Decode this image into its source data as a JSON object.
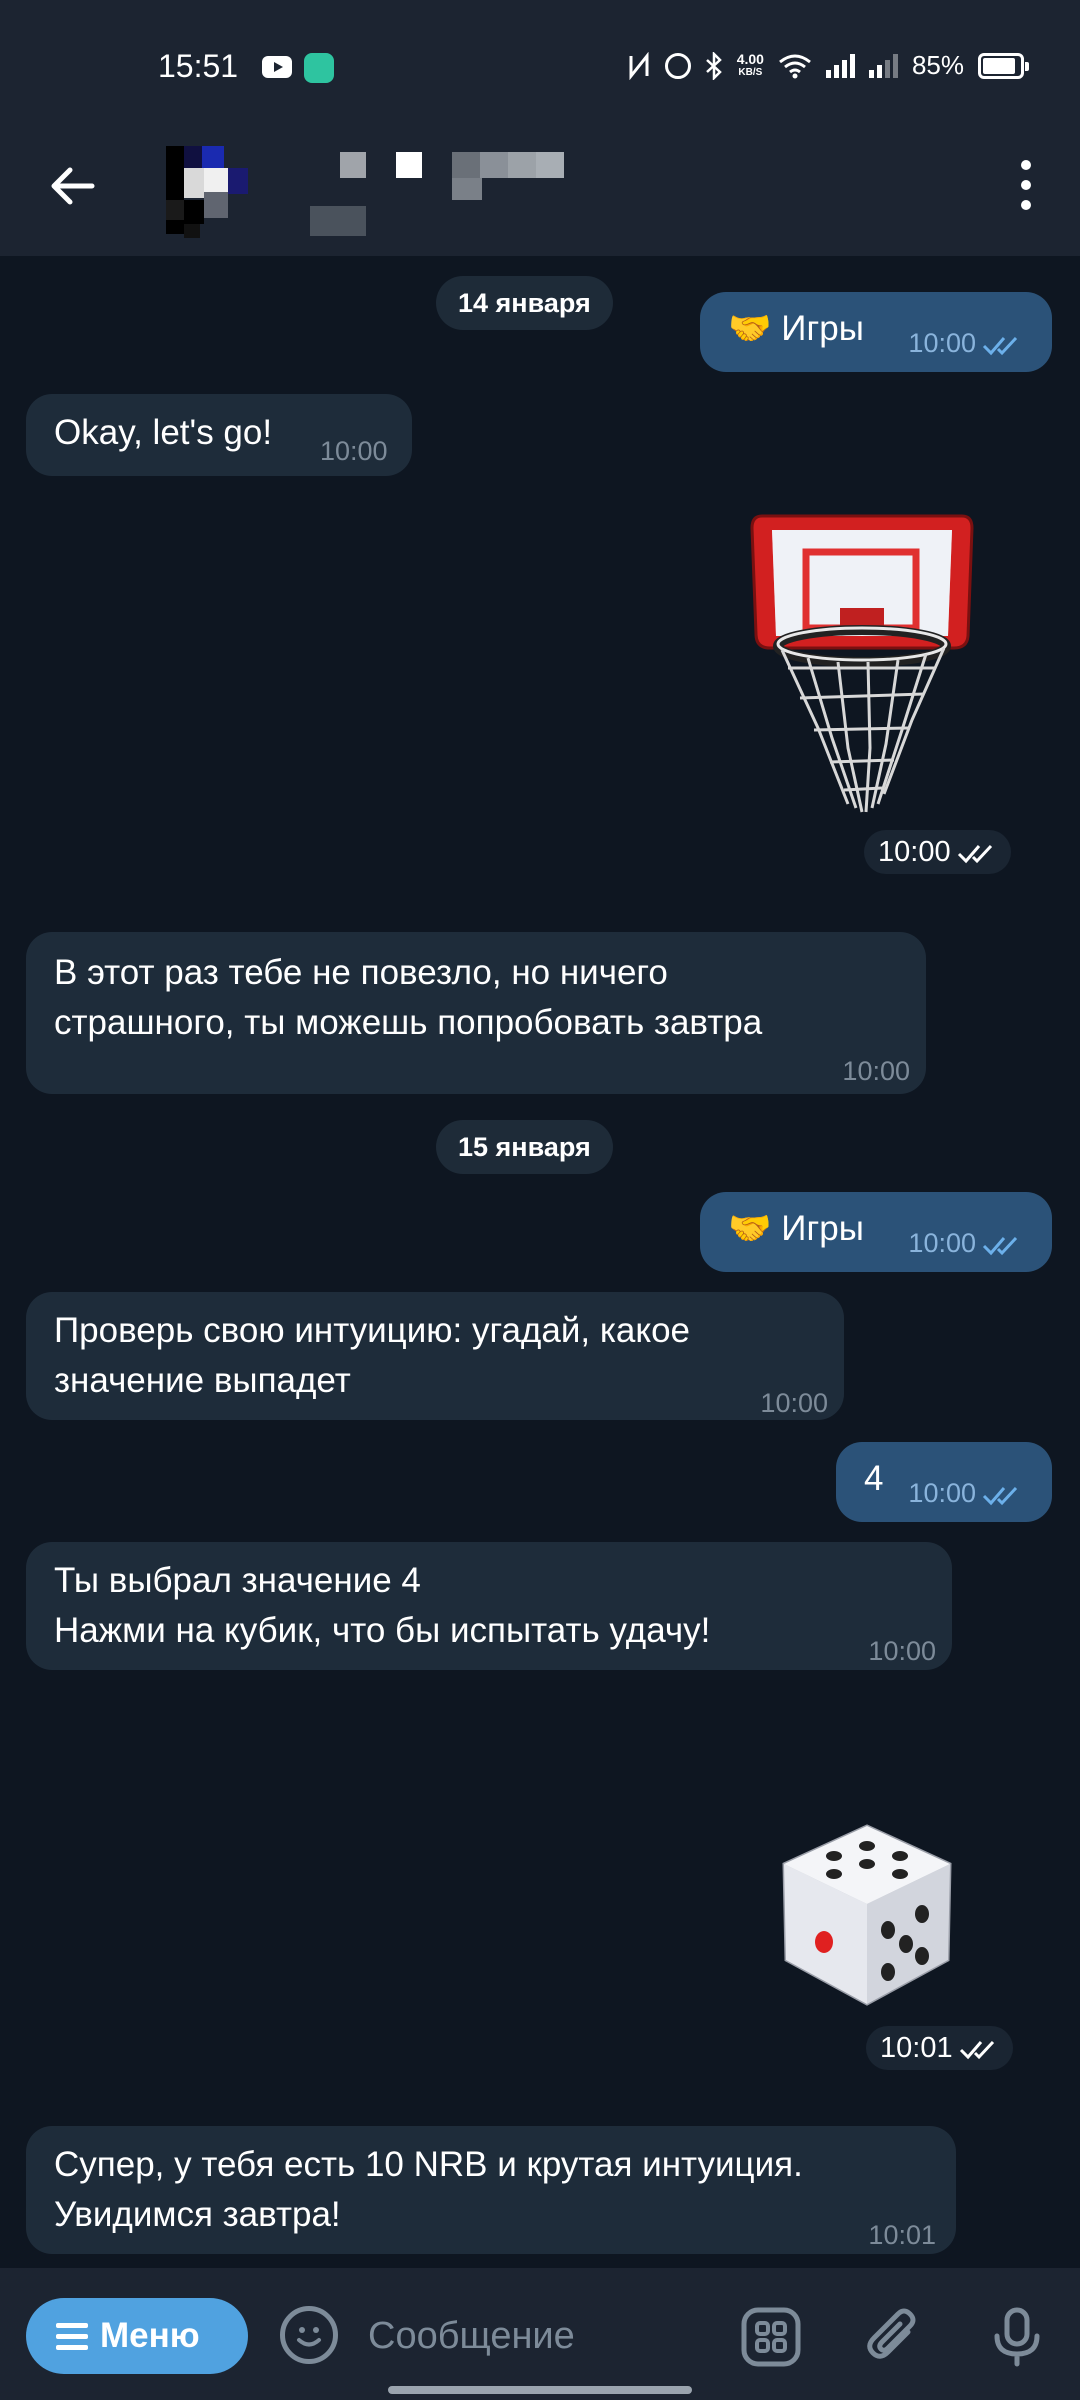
{
  "status_bar": {
    "time": "15:51",
    "net_speed_value": "4.00",
    "net_speed_unit": "KB/S",
    "battery": "85%"
  },
  "header": {
    "contact_name_redacted": true
  },
  "chat": {
    "dates": [
      "14 января",
      "15 января"
    ],
    "messages": [
      {
        "dir": "out",
        "text": "🤝 Игры",
        "time": "10:00"
      },
      {
        "dir": "in",
        "text": "Okay, let's go!",
        "time": "10:00"
      },
      {
        "dir": "out",
        "sticker": "basketball-hoop",
        "time": "10:00"
      },
      {
        "dir": "in",
        "text": "В этот раз тебе не повезло, но ничего\nстрашного, ты можешь попробовать завтра",
        "time": "10:00"
      },
      {
        "dir": "out",
        "text": "🤝 Игры",
        "time": "10:00"
      },
      {
        "dir": "in",
        "text": "Проверь свою интуицию: угадай, какое\nзначение выпадет",
        "time": "10:00"
      },
      {
        "dir": "out",
        "text": "4",
        "time": "10:00"
      },
      {
        "dir": "in",
        "text": "Ты выбрал значение 4\nНажми на кубик, что бы испытать удачу!",
        "time": "10:00"
      },
      {
        "dir": "out",
        "sticker": "dice",
        "time": "10:01"
      },
      {
        "dir": "in",
        "text": "Супер, у тебя есть 10 NRB и крутая интуиция.\nУвидимся завтра!",
        "time": "10:01"
      }
    ]
  },
  "bottom_bar": {
    "menu_label": "Меню",
    "input_placeholder": "Сообщение"
  },
  "colors": {
    "background": "#0e1621",
    "bar": "#1c2431",
    "incoming_bubble": "#1e2c3a",
    "outgoing_bubble": "#2b5278",
    "accent": "#50a2e0"
  },
  "icons": [
    "youtube-icon",
    "app-icon",
    "nfc-icon",
    "alarm-icon",
    "bluetooth-icon",
    "wifi-icon",
    "signal-icon",
    "battery-icon",
    "back-arrow-icon",
    "more-vert-icon",
    "double-check-icon",
    "menu-icon",
    "emoji-icon",
    "apps-icon",
    "attach-icon",
    "mic-icon"
  ]
}
